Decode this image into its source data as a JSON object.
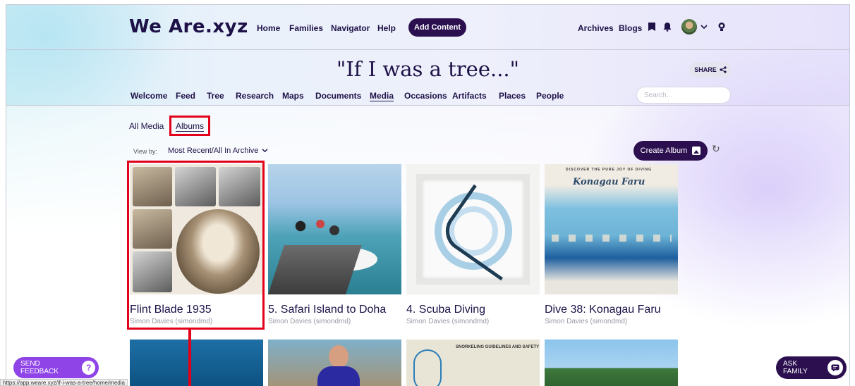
{
  "nav": {
    "logo": "We Are.xyz",
    "links": [
      "Home",
      "Families",
      "Navigator",
      "Help"
    ],
    "add_content": "Add Content",
    "right_links": [
      "Archives",
      "Blogs"
    ]
  },
  "header": {
    "title": "\"If I was a tree...\"",
    "share": "SHARE",
    "tabs": [
      "Welcome",
      "Feed",
      "Tree",
      "Research",
      "Maps",
      "Documents",
      "Media",
      "Occasions",
      "Artifacts",
      "Places",
      "People"
    ],
    "active_tab": "Media",
    "search_placeholder": "Search..."
  },
  "media": {
    "subtabs": [
      "All Media",
      "Albums"
    ],
    "active_subtab": "Albums",
    "view_by_label": "View by:",
    "view_by_value": "Most Recent/All In Archive",
    "create_album": "Create Album"
  },
  "albums": [
    {
      "title": "Flint Blade 1935",
      "owner": "Simon Davies (simondmd)"
    },
    {
      "title": "5. Safari Island to Doha",
      "owner": "Simon Davies (simondmd)"
    },
    {
      "title": "4. Scuba Diving",
      "owner": "Simon Davies (simondmd)"
    },
    {
      "title": "Dive 38: Konagau Faru",
      "owner": "Simon Davies (simondmd)"
    }
  ],
  "thumb_text": {
    "map_banner": "Konagau Faru",
    "map_tagline": "DISCOVER THE PURE JOY OF DIVING",
    "snorkel_sign": "SNORKELING GUIDELINES AND SAFETY"
  },
  "floating": {
    "feedback": "SEND FEEDBACK",
    "ask_family": "ASK FAMILY"
  },
  "status_url": "https://app.weare.xyz/if-i-was-a-tree/home/media",
  "colors": {
    "brand": "#2b0f4f",
    "feedback": "#8e44e6",
    "highlight": "#e2001a"
  }
}
